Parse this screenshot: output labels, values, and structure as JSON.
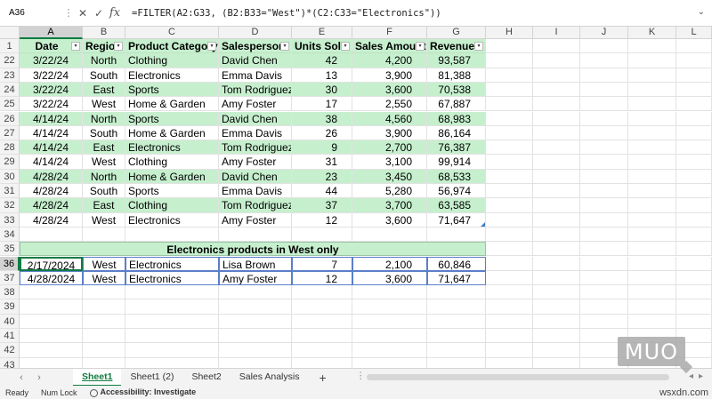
{
  "formula_bar": {
    "name_box": "A36",
    "fx": "fx",
    "formula": "=FILTER(A2:G33, (B2:B33=\"West\")*(C2:C33=\"Electronics\"))"
  },
  "columns": [
    "A",
    "B",
    "C",
    "D",
    "E",
    "F",
    "G",
    "H",
    "I",
    "J",
    "K",
    "L"
  ],
  "row_numbers": [
    "1",
    "22",
    "23",
    "24",
    "25",
    "26",
    "27",
    "28",
    "29",
    "30",
    "31",
    "32",
    "33",
    "34",
    "35",
    "36",
    "37",
    "38",
    "39",
    "40",
    "41",
    "42",
    "43"
  ],
  "table": {
    "headers": [
      "Date",
      "Region",
      "Product Category",
      "Salesperson",
      "Units Sold",
      "Sales Amount",
      "Revenue"
    ],
    "rows": [
      [
        "3/22/24",
        "North",
        "Clothing",
        "David Chen",
        "42",
        "4,200",
        "93,587"
      ],
      [
        "3/22/24",
        "South",
        "Electronics",
        "Emma Davis",
        "13",
        "3,900",
        "81,388"
      ],
      [
        "3/22/24",
        "East",
        "Sports",
        "Tom Rodriguez",
        "30",
        "3,600",
        "70,538"
      ],
      [
        "3/22/24",
        "West",
        "Home & Garden",
        "Amy Foster",
        "17",
        "2,550",
        "67,887"
      ],
      [
        "4/14/24",
        "North",
        "Sports",
        "David Chen",
        "38",
        "4,560",
        "68,983"
      ],
      [
        "4/14/24",
        "South",
        "Home & Garden",
        "Emma Davis",
        "26",
        "3,900",
        "86,164"
      ],
      [
        "4/14/24",
        "East",
        "Electronics",
        "Tom Rodriguez",
        "9",
        "2,700",
        "76,387"
      ],
      [
        "4/14/24",
        "West",
        "Clothing",
        "Amy Foster",
        "31",
        "3,100",
        "99,914"
      ],
      [
        "4/28/24",
        "North",
        "Home & Garden",
        "David Chen",
        "23",
        "3,450",
        "68,533"
      ],
      [
        "4/28/24",
        "South",
        "Sports",
        "Emma Davis",
        "44",
        "5,280",
        "56,974"
      ],
      [
        "4/28/24",
        "East",
        "Clothing",
        "Tom Rodriguez",
        "37",
        "3,700",
        "63,585"
      ],
      [
        "4/28/24",
        "West",
        "Electronics",
        "Amy Foster",
        "12",
        "3,600",
        "71,647"
      ]
    ]
  },
  "result": {
    "title": "Electronics products in West only",
    "rows": [
      [
        "2/17/2024",
        "West",
        "Electronics",
        "Lisa Brown",
        "7",
        "2,100",
        "60,846"
      ],
      [
        "4/28/2024",
        "West",
        "Electronics",
        "Amy Foster",
        "12",
        "3,600",
        "71,647"
      ]
    ]
  },
  "sheet_tabs": [
    "Sheet1",
    "Sheet1 (2)",
    "Sheet2",
    "Sales Analysis"
  ],
  "active_tab": "Sheet1",
  "add_sheet": "+",
  "status_bar": {
    "ready": "Ready",
    "num_lock": "Num Lock",
    "accessibility": "Accessibility: Investigate"
  },
  "watermark": {
    "logo": "MUO",
    "site": "wsxdn.com"
  },
  "colors": {
    "header_fill": "#c6efce",
    "band_fill": "#c6efce",
    "accent": "#107c41",
    "result_border": "#5b7fc7"
  }
}
